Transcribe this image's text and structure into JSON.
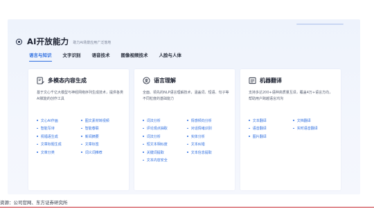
{
  "header": {
    "title": "AI开放能力",
    "subtitle": "助力AI场景应用广泛落地"
  },
  "tabs": [
    {
      "label": "语言与知识",
      "active": true
    },
    {
      "label": "文字识别",
      "active": false
    },
    {
      "label": "语音技术",
      "active": false
    },
    {
      "label": "图像视频技术",
      "active": false
    },
    {
      "label": "人脸与人体",
      "active": false
    }
  ],
  "cards": [
    {
      "icon": "document-edit-icon",
      "title": "多模态内容生成",
      "desc": "基于文心千亿大模型与神经网络序列生成技术，提供各类AI赋能的创作工具",
      "items": [
        "文心AI作画",
        "图文素材转视频",
        "智能写诗",
        "智能春联",
        "祝福语生成",
        "新闻摘要",
        "文章标题生成",
        "文章标签",
        "文章分类",
        "词义词推荐"
      ]
    },
    {
      "icon": "translate-icon",
      "title": "语言理解",
      "desc": "全面、领先的NLP语言理解技术，涵盖词、短语、句子等不同粒度的基础能力",
      "items": [
        "词法分析",
        "情感倾向分析",
        "评论观点抽取",
        "对话情绪识别",
        "词法分析",
        "实体分析",
        "短文本相似度",
        "文本纠错",
        "关键词提取",
        "文本信息提取",
        "文本内容安全"
      ]
    },
    {
      "icon": "machine-translation-icon",
      "title": "机器翻译",
      "desc": "支持多达200+语种高质量互译，覆盖4万+语言方向，帮助用户跨越语言鸿沟",
      "items": [
        "文本翻译",
        "文档翻译",
        "语音翻译",
        "实时语音翻译",
        "图片翻译"
      ]
    }
  ],
  "source": "资源：公司官网、东方证券研究所",
  "colors": {
    "accent": "#2f6fe0",
    "panel_bg": "#eef3fc",
    "rule": "#c4252c"
  }
}
